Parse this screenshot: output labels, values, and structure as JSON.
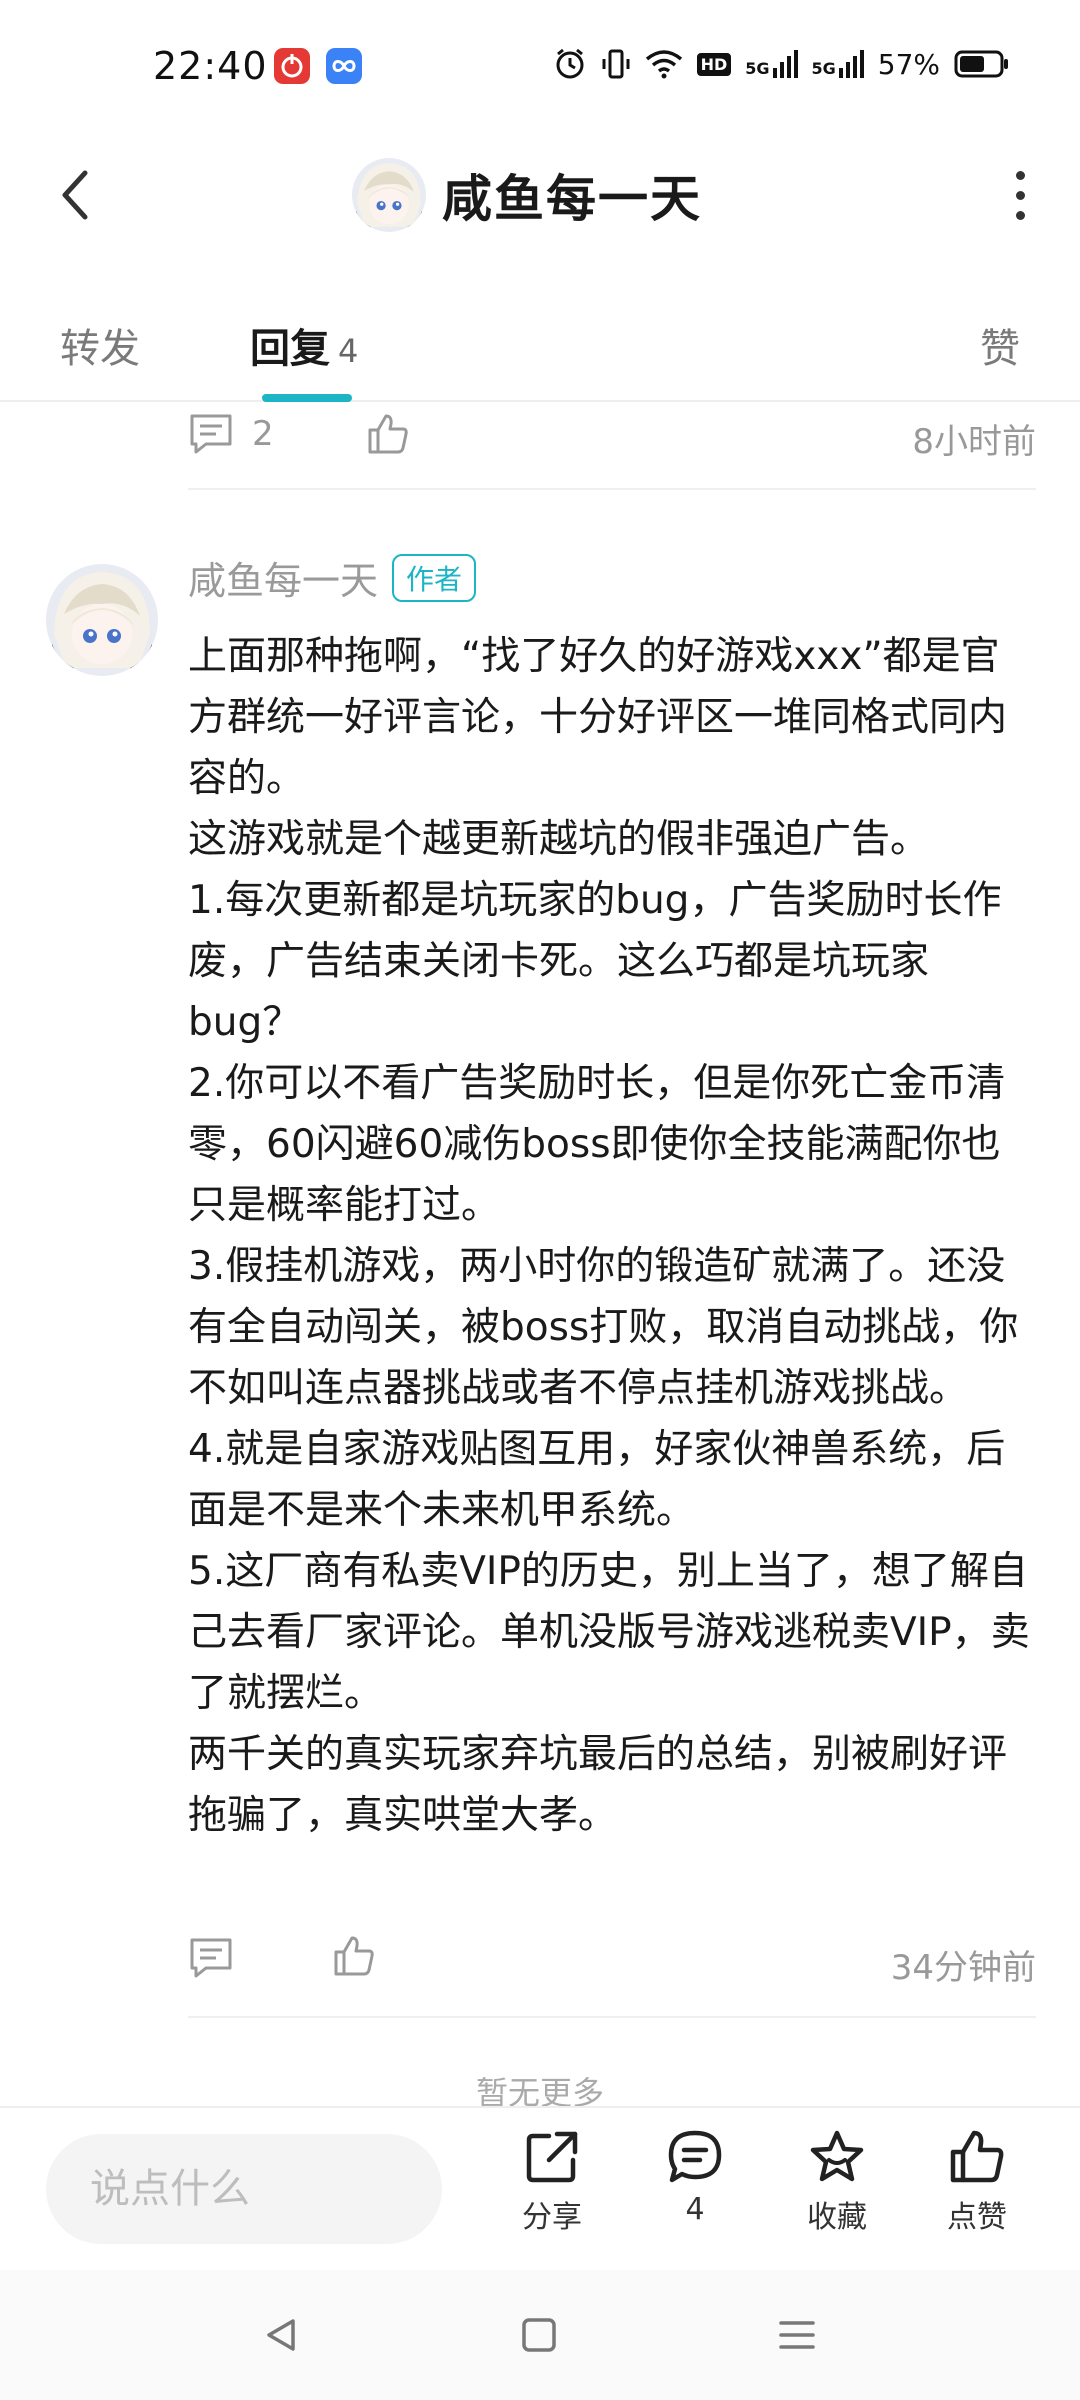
{
  "status_bar": {
    "time": "22:40",
    "network_1": "5G",
    "network_2": "5G",
    "hd_label": "HD",
    "battery": "57%"
  },
  "header": {
    "title": "咸鱼每一天"
  },
  "tabs": {
    "forward": "转发",
    "reply": "回复",
    "reply_count": "4",
    "like": "赞"
  },
  "previous_comment": {
    "comment_count": "2",
    "time": "8小时前"
  },
  "reply": {
    "author": "咸鱼每一天",
    "badge": "作者",
    "paragraphs": [
      "上面那种拖啊，“找了好久的好游戏xxx”都是官方群统一好评言论，十分好评区一堆同格式同内容的。",
      "这游戏就是个越更新越坑的假非强迫广告。",
      "1.每次更新都是坑玩家的bug，广告奖励时长作废，广告结束关闭卡死。这么巧都是坑玩家bug？",
      "2.你可以不看广告奖励时长，但是你死亡金币清零，60闪避60减伤boss即使你全技能满配你也只是概率能打过。",
      "3.假挂机游戏，两小时你的锻造矿就满了。还没有全自动闯关，被boss打败，取消自动挑战，你不如叫连点器挑战或者不停点挂机游戏挑战。",
      "4.就是自家游戏贴图互用，好家伙神兽系统，后面是不是来个未来机甲系统。",
      "5.这厂商有私卖VIP的历史，别上当了，想了解自己去看厂家评论。单机没版号游戏逃税卖VIP，卖了就摆烂。",
      "两千关的真实玩家弃坑最后的总结，别被刷好评拖骗了，真实哄堂大孝。"
    ],
    "time": "34分钟前"
  },
  "no_more": "暂无更多",
  "bottom_bar": {
    "input_placeholder": "说点什么",
    "share_label": "分享",
    "comment_count": "4",
    "favorite_label": "收藏",
    "like_label": "点赞"
  },
  "colors": {
    "accent": "#1bb5c6",
    "muted_text": "#999999"
  }
}
